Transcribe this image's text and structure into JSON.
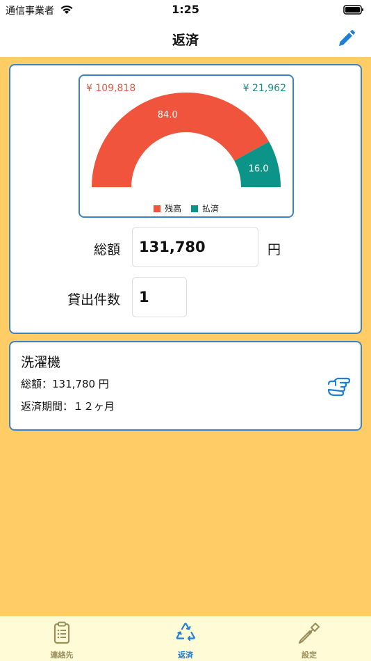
{
  "status_bar": {
    "carrier": "通信事業者",
    "time": "1:25"
  },
  "nav": {
    "title": "返済",
    "edit_icon": "pencil-icon"
  },
  "summary": {
    "remaining_amount": "¥ 109,818",
    "paid_amount": "¥ 21,962",
    "remaining_percent_label": "84.0",
    "paid_percent_label": "16.0",
    "legend": [
      {
        "label": "残高",
        "color": "#f0543d"
      },
      {
        "label": "払済",
        "color": "#0d9488"
      }
    ],
    "total_label": "総額",
    "total_value": "131,780",
    "total_unit": "円",
    "loan_count_label": "貸出件数",
    "loan_count_value": "1"
  },
  "chart_data": {
    "type": "pie",
    "variant": "half-donut gauge",
    "categories": [
      "残高",
      "払済"
    ],
    "values": [
      84.0,
      16.0
    ],
    "colors": [
      "#f0543d",
      "#0d9488"
    ],
    "annotations": [
      "¥ 109,818",
      "¥ 21,962"
    ],
    "legend_position": "bottom"
  },
  "loan_item": {
    "title": "洗濯機",
    "total": "総額：131,780 円",
    "term": "返済期間：１２ヶ月",
    "action_icon": "pointing-hand-icon"
  },
  "tabs": [
    {
      "label": "連絡先",
      "icon": "clipboard-list-icon",
      "color": "#9a8f5c"
    },
    {
      "label": "返済",
      "icon": "recycle-icon",
      "color": "#1e7fd8",
      "selected": true
    },
    {
      "label": "設定",
      "icon": "screwdriver-icon",
      "color": "#9a8f5c"
    }
  ]
}
